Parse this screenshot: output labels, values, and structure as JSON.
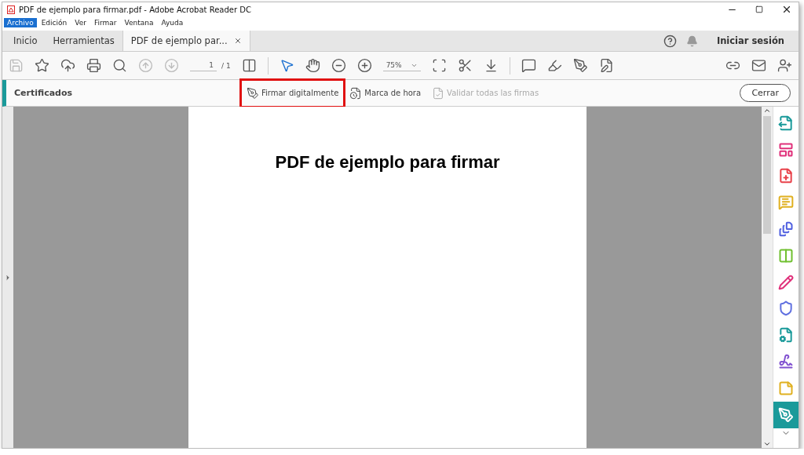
{
  "window": {
    "title": "PDF de ejemplo para firmar.pdf - Adobe Acrobat Reader DC"
  },
  "menu": [
    {
      "label": "Archivo",
      "selected": true
    },
    {
      "label": "Edición",
      "selected": false
    },
    {
      "label": "Ver",
      "selected": false
    },
    {
      "label": "Firmar",
      "selected": false
    },
    {
      "label": "Ventana",
      "selected": false
    },
    {
      "label": "Ayuda",
      "selected": false
    }
  ],
  "tabs": [
    {
      "label": "Inicio",
      "selected": false
    },
    {
      "label": "Herramientas",
      "selected": false
    },
    {
      "label": "PDF de ejemplo par...",
      "selected": true
    }
  ],
  "account": {
    "sign_in": "Iniciar sesión"
  },
  "toolbar": {
    "left": [
      {
        "kind": "save",
        "disabled": true,
        "selected": false
      },
      {
        "kind": "star",
        "disabled": false,
        "selected": false
      },
      {
        "kind": "upload",
        "disabled": false,
        "selected": false
      },
      {
        "kind": "print",
        "disabled": false,
        "selected": false
      },
      {
        "kind": "search",
        "disabled": false,
        "selected": false
      },
      {
        "kind": "up",
        "disabled": true,
        "selected": false
      },
      {
        "kind": "down",
        "disabled": true,
        "selected": false
      }
    ],
    "page": "1",
    "page_total": "/ 1",
    "middle": [
      {
        "kind": "pages",
        "disabled": false,
        "selected": false
      },
      {
        "kind": "pointer",
        "disabled": false,
        "selected": true
      },
      {
        "kind": "hand",
        "disabled": false,
        "selected": false
      },
      {
        "kind": "zoomout",
        "disabled": false,
        "selected": false
      },
      {
        "kind": "zoomin",
        "disabled": false,
        "selected": false
      }
    ],
    "zoom": "75%",
    "right": [
      {
        "kind": "fit",
        "disabled": false,
        "selected": false
      },
      {
        "kind": "scan",
        "disabled": false,
        "selected": false
      },
      {
        "kind": "scroll",
        "disabled": false,
        "selected": false
      },
      {
        "kind": "comment",
        "disabled": false,
        "selected": false
      },
      {
        "kind": "highlight",
        "disabled": false,
        "selected": false
      },
      {
        "kind": "sign",
        "disabled": false,
        "selected": false
      },
      {
        "kind": "edit",
        "disabled": false,
        "selected": false
      }
    ],
    "share": [
      {
        "kind": "link",
        "disabled": false,
        "selected": false
      },
      {
        "kind": "mail",
        "disabled": false,
        "selected": false
      },
      {
        "kind": "user",
        "disabled": false,
        "selected": false
      }
    ]
  },
  "tool_bar": {
    "title": "Certificados",
    "actions": [
      {
        "kind": "sign",
        "label": "Firmar digitalmente",
        "disabled": false,
        "highlighted": true
      },
      {
        "kind": "timestamp",
        "label": "Marca de hora",
        "disabled": false,
        "highlighted": false
      },
      {
        "kind": "validate",
        "label": "Validar todas las firmas",
        "disabled": true,
        "highlighted": false
      }
    ],
    "close": "Cerrar"
  },
  "document": {
    "heading": "PDF de ejemplo para firmar"
  },
  "tools_panel": [
    {
      "kind": "export",
      "color": "#1a9a9a",
      "selected": false
    },
    {
      "kind": "form",
      "color": "#e0307a",
      "selected": false
    },
    {
      "kind": "create",
      "color": "#e8414a",
      "selected": false
    },
    {
      "kind": "comment",
      "color": "#e0b020",
      "selected": false
    },
    {
      "kind": "combine",
      "color": "#5060e0",
      "selected": false
    },
    {
      "kind": "organize",
      "color": "#70c030",
      "selected": false
    },
    {
      "kind": "fill",
      "color": "#e0307a",
      "selected": false
    },
    {
      "kind": "protect",
      "color": "#6070e0",
      "selected": false
    },
    {
      "kind": "optimize",
      "color": "#1a9a9a",
      "selected": false
    },
    {
      "kind": "signature",
      "color": "#8050d0",
      "selected": false
    },
    {
      "kind": "note",
      "color": "#e0b020",
      "selected": false
    },
    {
      "kind": "certificate",
      "color": "#1a9a9a",
      "selected": true
    }
  ]
}
